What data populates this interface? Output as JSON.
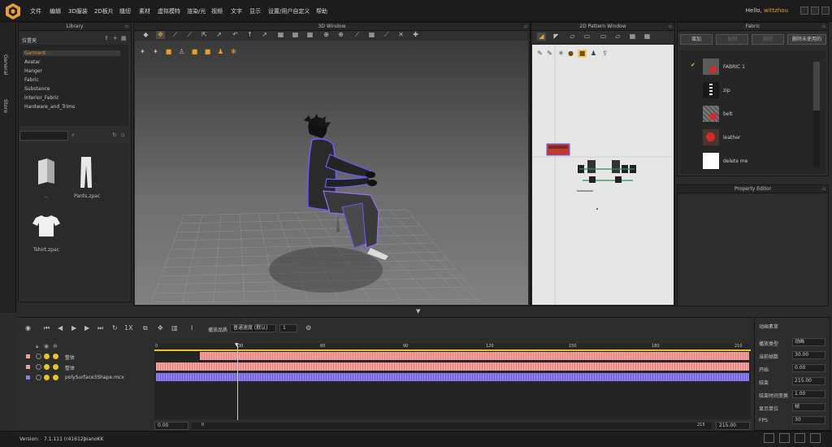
{
  "menu": [
    "文件",
    "编辑",
    "3D服装",
    "2D板片",
    "缝纫",
    "素材",
    "虚拟模特",
    "渲染/光",
    "视频",
    "文字",
    "显示",
    "设置/用户自定义",
    "帮助"
  ],
  "user": {
    "greeting": "Hello,",
    "name": "wittzhou"
  },
  "side_tabs": [
    "General",
    "Store"
  ],
  "library": {
    "title": "Library",
    "folder": "位置夹",
    "tree": [
      "Garment",
      "Avatar",
      "Hanger",
      "Fabric",
      "Substance",
      "Interior_Fabric",
      "Hardware_and_Trims"
    ],
    "thumbs": [
      "..",
      "Pants.zpac",
      "Tshirt.zpac"
    ]
  },
  "view3d": {
    "title": "3D Window"
  },
  "view2d": {
    "title": "2D Pattern Window"
  },
  "fabric": {
    "title": "Fabric",
    "buttons": [
      "增加",
      "复制",
      "删除",
      "删除未使用的"
    ],
    "items": [
      {
        "name": "FABRIC 1",
        "color": "#5a5a5a"
      },
      {
        "name": "zip",
        "color": "#1a1a1a"
      },
      {
        "name": "belt",
        "color": "#6a6a6a"
      },
      {
        "name": "leather",
        "color": "#4a3530"
      },
      {
        "name": "delete me",
        "color": "#ffffff"
      }
    ]
  },
  "property_editor": {
    "title": "Property Editor"
  },
  "timeline": {
    "mode_label": "播放品质",
    "mode_value": "普通速度 (默认)",
    "mode_num": "1",
    "ruler": [
      "0",
      "30",
      "60",
      "90",
      "120",
      "150",
      "180",
      "210"
    ],
    "tracks": [
      {
        "name": "整体",
        "color": "#f2a0a0"
      },
      {
        "name": "整体",
        "color": "#f2a0a0"
      },
      {
        "name": "polySurface3Shape.mcx",
        "color": "#8a7ef0"
      }
    ],
    "start_value": "0.00",
    "scroll_start": "0",
    "scroll_end": "215",
    "end_value": "215.00"
  },
  "props": {
    "title": "动画素草",
    "rows": [
      {
        "label": "播放类型",
        "value": "动画"
      },
      {
        "label": "当前帧数",
        "value": "30.00"
      },
      {
        "label": "开始",
        "value": "0.00"
      },
      {
        "label": "结束",
        "value": "215.00"
      },
      {
        "label": "结束时间变换",
        "value": "1.00"
      },
      {
        "label": "显示单位",
        "value": "帧"
      },
      {
        "label": "FPS",
        "value": "30"
      }
    ]
  },
  "status": {
    "version_label": "Version:",
    "version": "7.1.111 (r41612)",
    "user": "pianoKK"
  }
}
